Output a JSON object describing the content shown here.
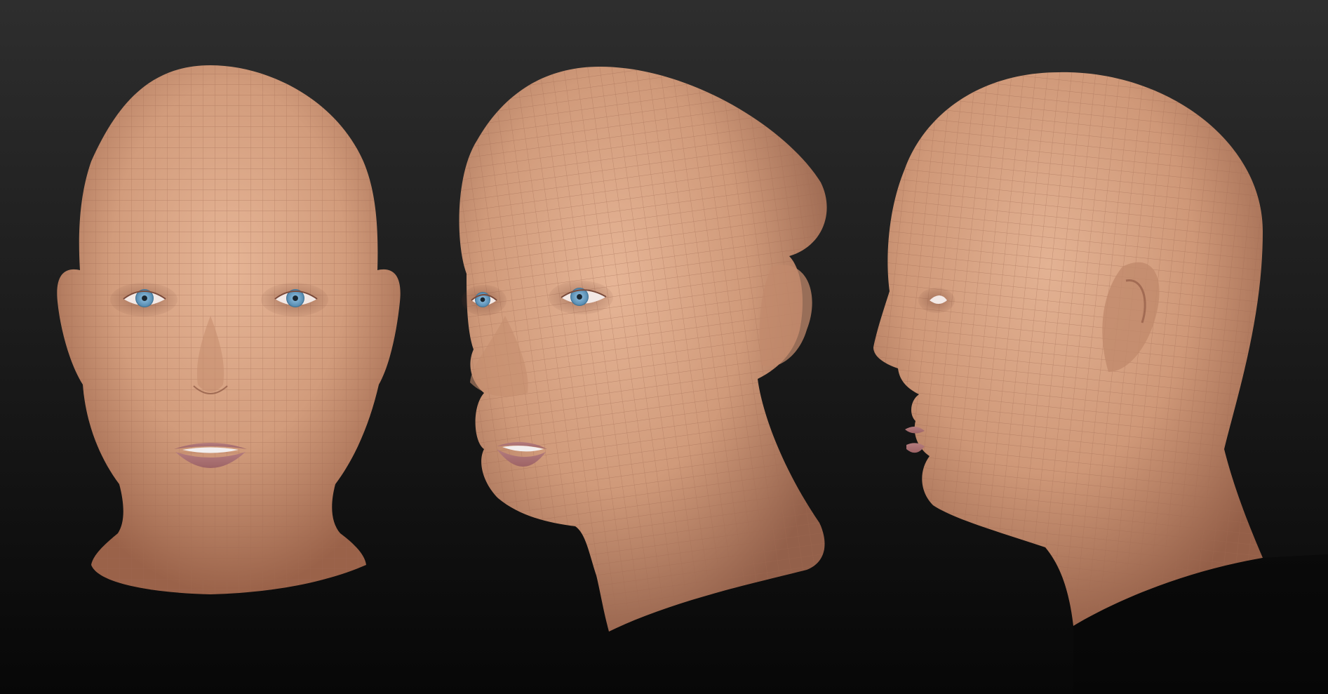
{
  "scene": {
    "background": {
      "top": "#2e2e2e",
      "bottom": "#070707"
    },
    "skin": {
      "light": "#e0ae8f",
      "mid": "#c99274",
      "shadow": "#8e5a44"
    },
    "wireframe_color": "#a06a52",
    "lip_color": "#b47c7e",
    "iris_color": "#5a8fb4",
    "views": [
      {
        "name": "front",
        "label": ""
      },
      {
        "name": "three-quarter",
        "label": ""
      },
      {
        "name": "profile",
        "label": ""
      }
    ]
  }
}
